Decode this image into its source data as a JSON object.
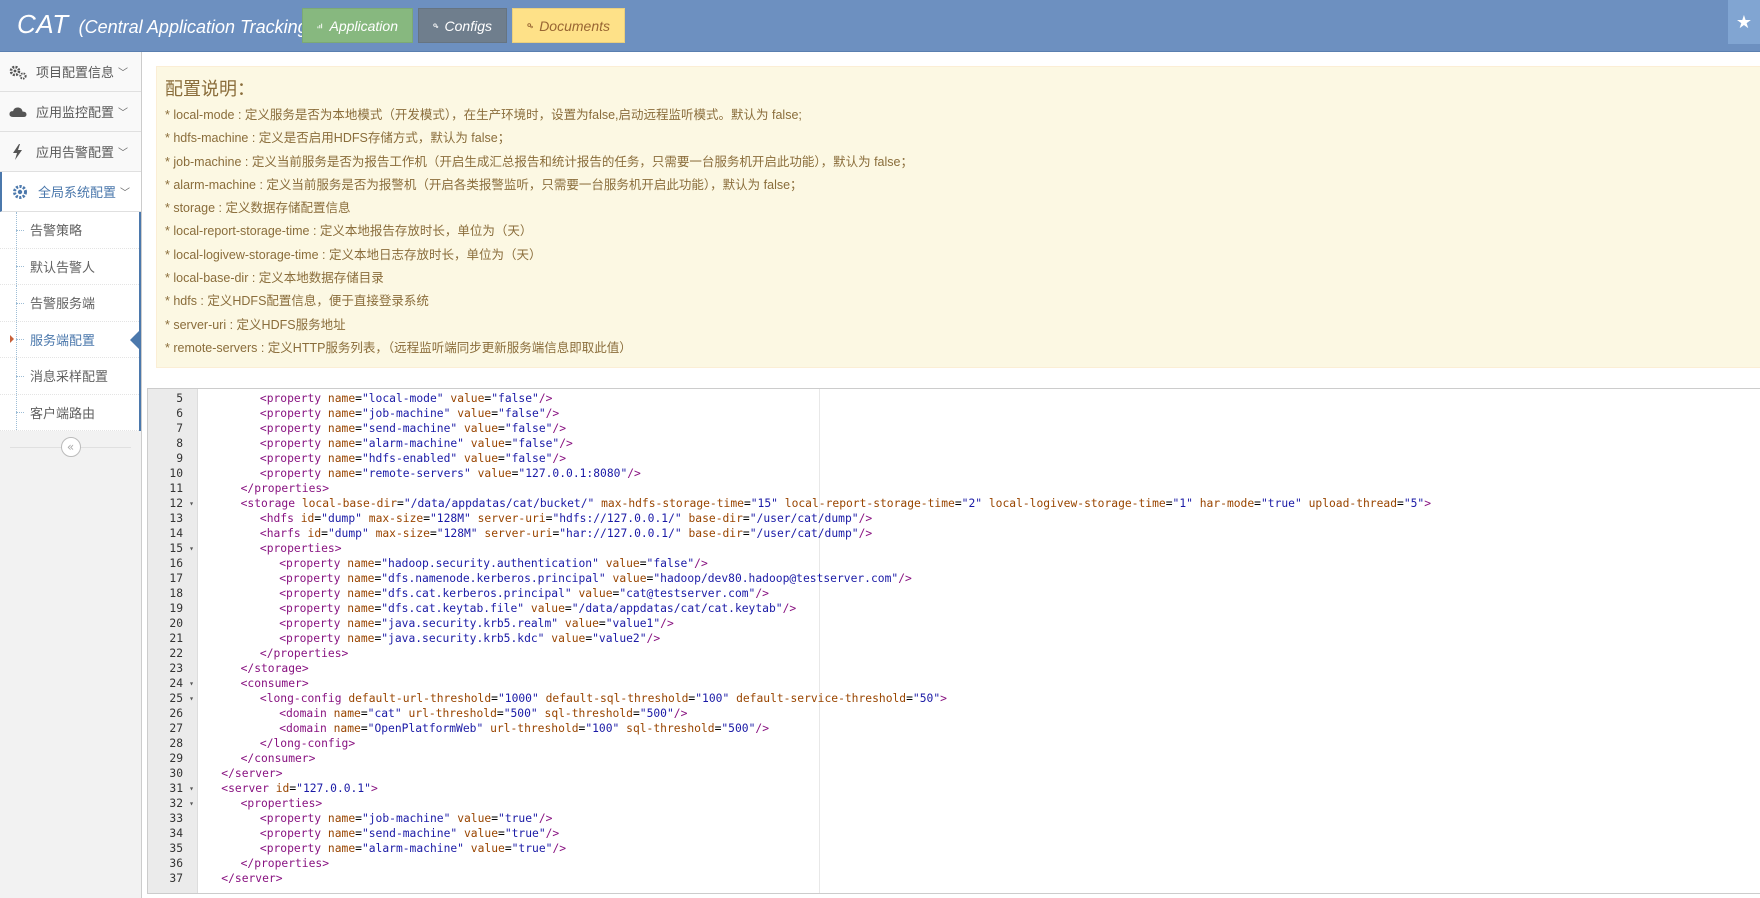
{
  "navbar": {
    "brand": "CAT",
    "brand_sub": "(Central Application Tracking)",
    "buttons": [
      {
        "label": "Application",
        "icon": "bar-chart-icon"
      },
      {
        "label": "Configs",
        "icon": "gears-icon"
      },
      {
        "label": "Documents",
        "icon": "gears-icon"
      }
    ],
    "star": "★"
  },
  "sidebar": {
    "menus": [
      {
        "label": "项目配置信息",
        "icon": "gears-icon"
      },
      {
        "label": "应用监控配置",
        "icon": "cloud-icon"
      },
      {
        "label": "应用告警配置",
        "icon": "bolt-icon"
      },
      {
        "label": "全局系统配置",
        "icon": "gear-icon"
      }
    ],
    "chevron": "﹀",
    "sub_items": [
      "告警策略",
      "默认告警人",
      "告警服务端",
      "服务端配置",
      "消息采样配置",
      "客户端路由"
    ],
    "active_sub": "服务端配置",
    "collapse": "«"
  },
  "note": {
    "title": "配置说明：",
    "lines": [
      "* local-mode : 定义服务是否为本地模式（开发模式），在生产环境时，设置为false,启动远程监听模式。默认为 false;",
      "* hdfs-machine : 定义是否启用HDFS存储方式，默认为 false；",
      "* job-machine : 定义当前服务是否为报告工作机（开启生成汇总报告和统计报告的任务，只需要一台服务机开启此功能），默认为 false；",
      "* alarm-machine : 定义当前服务是否为报警机（开启各类报警监听，只需要一台服务机开启此功能），默认为 false；",
      "* storage : 定义数据存储配置信息",
      "* local-report-storage-time : 定义本地报告存放时长，单位为（天）",
      "* local-logivew-storage-time : 定义本地日志存放时长，单位为（天）",
      "* local-base-dir : 定义本地数据存储目录",
      "* hdfs : 定义HDFS配置信息，便于直接登录系统",
      "* server-uri : 定义HDFS服务地址",
      "* remote-servers : 定义HTTP服务列表，（远程监听端同步更新服务端信息即取此值）"
    ]
  },
  "editor": {
    "lines": [
      {
        "n": "5",
        "fold": false,
        "indent": 3,
        "code": "<property name=\"local-mode\" value=\"false\"/>"
      },
      {
        "n": "6",
        "fold": false,
        "indent": 3,
        "code": "<property name=\"job-machine\" value=\"false\"/>"
      },
      {
        "n": "7",
        "fold": false,
        "indent": 3,
        "code": "<property name=\"send-machine\" value=\"false\"/>"
      },
      {
        "n": "8",
        "fold": false,
        "indent": 3,
        "code": "<property name=\"alarm-machine\" value=\"false\"/>"
      },
      {
        "n": "9",
        "fold": false,
        "indent": 3,
        "code": "<property name=\"hdfs-enabled\" value=\"false\"/>"
      },
      {
        "n": "10",
        "fold": false,
        "indent": 3,
        "code": "<property name=\"remote-servers\" value=\"127.0.0.1:8080\"/>"
      },
      {
        "n": "11",
        "fold": false,
        "indent": 2,
        "code": "</properties>"
      },
      {
        "n": "12",
        "fold": true,
        "indent": 2,
        "code": "<storage local-base-dir=\"/data/appdatas/cat/bucket/\" max-hdfs-storage-time=\"15\" local-report-storage-time=\"2\" local-logivew-storage-time=\"1\" har-mode=\"true\" upload-thread=\"5\">"
      },
      {
        "n": "13",
        "fold": false,
        "indent": 3,
        "code": "<hdfs id=\"dump\" max-size=\"128M\" server-uri=\"hdfs://127.0.0.1/\" base-dir=\"/user/cat/dump\"/>"
      },
      {
        "n": "14",
        "fold": false,
        "indent": 3,
        "code": "<harfs id=\"dump\" max-size=\"128M\" server-uri=\"har://127.0.0.1/\" base-dir=\"/user/cat/dump\"/>"
      },
      {
        "n": "15",
        "fold": true,
        "indent": 3,
        "code": "<properties>"
      },
      {
        "n": "16",
        "fold": false,
        "indent": 4,
        "code": "<property name=\"hadoop.security.authentication\" value=\"false\"/>"
      },
      {
        "n": "17",
        "fold": false,
        "indent": 4,
        "code": "<property name=\"dfs.namenode.kerberos.principal\" value=\"hadoop/dev80.hadoop@testserver.com\"/>"
      },
      {
        "n": "18",
        "fold": false,
        "indent": 4,
        "code": "<property name=\"dfs.cat.kerberos.principal\" value=\"cat@testserver.com\"/>"
      },
      {
        "n": "19",
        "fold": false,
        "indent": 4,
        "code": "<property name=\"dfs.cat.keytab.file\" value=\"/data/appdatas/cat/cat.keytab\"/>"
      },
      {
        "n": "20",
        "fold": false,
        "indent": 4,
        "code": "<property name=\"java.security.krb5.realm\" value=\"value1\"/>"
      },
      {
        "n": "21",
        "fold": false,
        "indent": 4,
        "code": "<property name=\"java.security.krb5.kdc\" value=\"value2\"/>"
      },
      {
        "n": "22",
        "fold": false,
        "indent": 3,
        "code": "</properties>"
      },
      {
        "n": "23",
        "fold": false,
        "indent": 2,
        "code": "</storage>"
      },
      {
        "n": "24",
        "fold": true,
        "indent": 2,
        "code": "<consumer>"
      },
      {
        "n": "25",
        "fold": true,
        "indent": 3,
        "code": "<long-config default-url-threshold=\"1000\" default-sql-threshold=\"100\" default-service-threshold=\"50\">"
      },
      {
        "n": "26",
        "fold": false,
        "indent": 4,
        "code": "<domain name=\"cat\" url-threshold=\"500\" sql-threshold=\"500\"/>"
      },
      {
        "n": "27",
        "fold": false,
        "indent": 4,
        "code": "<domain name=\"OpenPlatformWeb\" url-threshold=\"100\" sql-threshold=\"500\"/>"
      },
      {
        "n": "28",
        "fold": false,
        "indent": 3,
        "code": "</long-config>"
      },
      {
        "n": "29",
        "fold": false,
        "indent": 2,
        "code": "</consumer>"
      },
      {
        "n": "30",
        "fold": false,
        "indent": 1,
        "code": "</server>"
      },
      {
        "n": "31",
        "fold": true,
        "indent": 1,
        "code": "<server id=\"127.0.0.1\">"
      },
      {
        "n": "32",
        "fold": true,
        "indent": 2,
        "code": "<properties>"
      },
      {
        "n": "33",
        "fold": false,
        "indent": 3,
        "code": "<property name=\"job-machine\" value=\"true\"/>"
      },
      {
        "n": "34",
        "fold": false,
        "indent": 3,
        "code": "<property name=\"send-machine\" value=\"true\"/>"
      },
      {
        "n": "35",
        "fold": false,
        "indent": 3,
        "code": "<property name=\"alarm-machine\" value=\"true\"/>"
      },
      {
        "n": "36",
        "fold": false,
        "indent": 2,
        "code": "</properties>"
      },
      {
        "n": "37",
        "fold": false,
        "indent": 1,
        "code": "</server>"
      }
    ]
  },
  "colors": {
    "navbar": "#6d90c0",
    "application": "#87b87f",
    "configs": "#6f7e8d",
    "documents": "#fee188",
    "note_bg": "#fcf8e3",
    "note_text": "#8a6d3b",
    "active": "#4b78ac"
  }
}
